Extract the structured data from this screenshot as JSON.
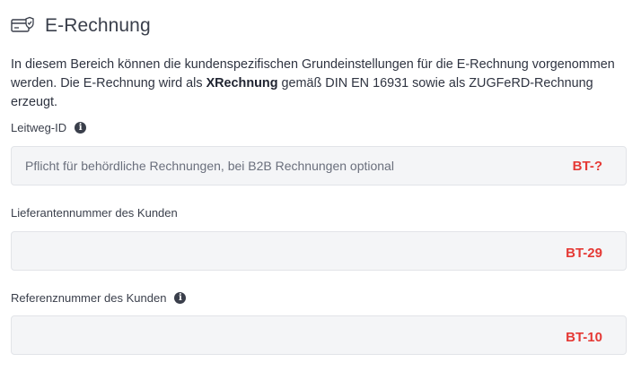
{
  "section": {
    "icon": "invoice-card-check-icon",
    "title": "E-Rechnung",
    "description_before": "In diesem Bereich können die kundenspezifischen Grundeinstellungen für die E-Rechnung vorgenommen werden. Die E-Rechnung wird als ",
    "description_bold": "XRechnung",
    "description_after": " gemäß DIN EN 16931 sowie als ZUGFeRD-Rechnung erzeugt."
  },
  "fields": [
    {
      "label": "Leitweg-ID",
      "has_info": true,
      "value": "",
      "placeholder": "Pflicht für behördliche Rechnungen, bei B2B Rechnungen optional",
      "annotation": "BT-?"
    },
    {
      "label": "Lieferantennummer des Kunden",
      "has_info": false,
      "value": "",
      "placeholder": "",
      "annotation": "BT-29"
    },
    {
      "label": "Referenznummer des Kunden",
      "has_info": true,
      "value": "",
      "placeholder": "",
      "annotation": "BT-10"
    }
  ],
  "colors": {
    "annotation": "#e53935",
    "field_background": "#f4f5f7",
    "text": "#3a3f4b"
  }
}
